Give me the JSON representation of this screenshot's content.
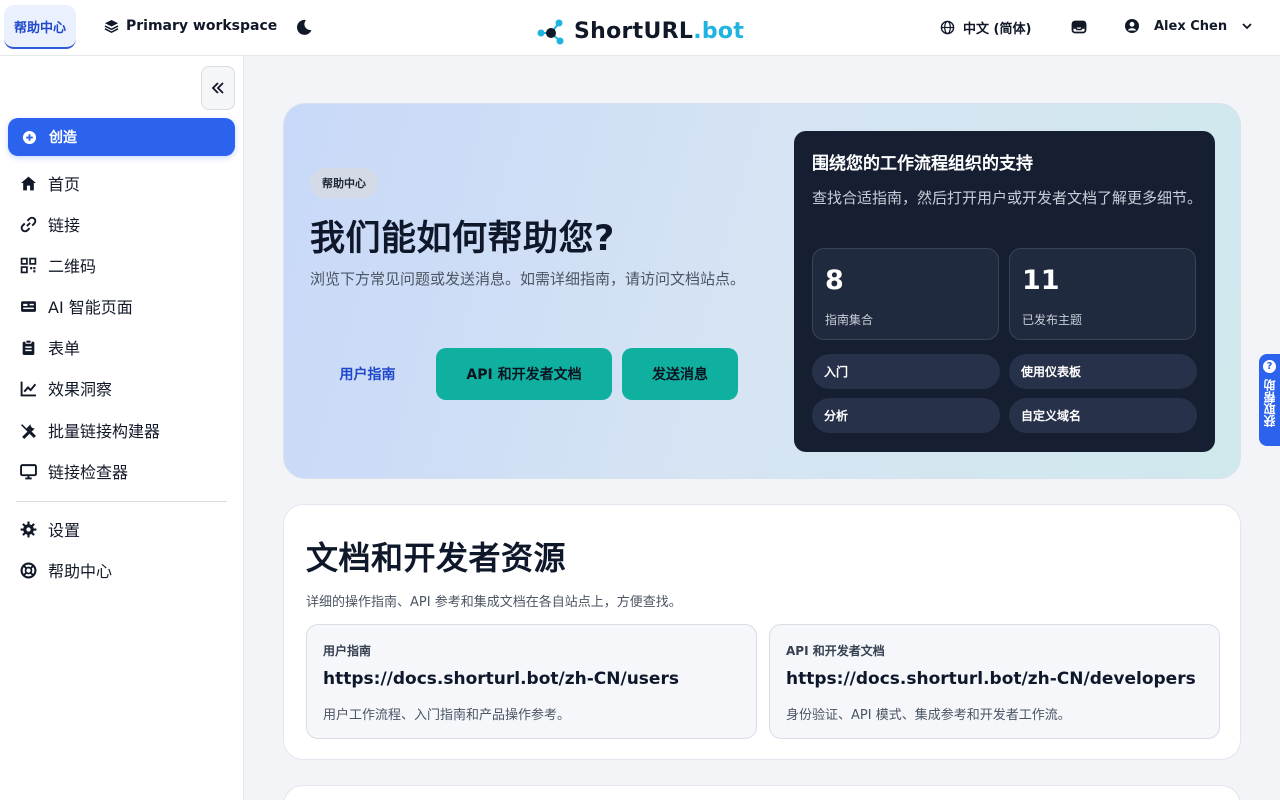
{
  "topbar": {
    "help_tab": "帮助中心",
    "workspace": "Primary workspace",
    "logo_main": "ShortURL",
    "logo_suffix": ".bot",
    "language": "中文 (简体)",
    "user_name": "Alex Chen"
  },
  "sidebar": {
    "create_label": "创造",
    "items": [
      {
        "label": "首页",
        "icon": "home-icon"
      },
      {
        "label": "链接",
        "icon": "link-icon"
      },
      {
        "label": "二维码",
        "icon": "qr-code-icon"
      },
      {
        "label": "AI 智能页面",
        "icon": "id-card-icon"
      },
      {
        "label": "表单",
        "icon": "clipboard-icon"
      },
      {
        "label": "效果洞察",
        "icon": "chart-line-icon"
      },
      {
        "label": "批量链接构建器",
        "icon": "tools-icon"
      },
      {
        "label": "链接检查器",
        "icon": "monitor-icon"
      },
      {
        "label": "设置",
        "icon": "gear-icon"
      },
      {
        "label": "帮助中心",
        "icon": "life-ring-icon"
      }
    ]
  },
  "hero": {
    "badge": "帮助中心",
    "title": "我们能如何帮助您?",
    "subtitle": "浏览下方常见问题或发送消息。如需详细指南，请访问文档站点。",
    "btn_user_guide": "用户指南",
    "btn_api_docs": "API 和开发者文档",
    "btn_send_message": "发送消息",
    "card": {
      "title": "围绕您的工作流程组织的支持",
      "desc": "查找合适指南，然后打开用户或开发者文档了解更多细节。",
      "stats": [
        {
          "value": "8",
          "label": "指南集合"
        },
        {
          "value": "11",
          "label": "已发布主题"
        }
      ],
      "topics": [
        "入门",
        "使用仪表板",
        "分析",
        "自定义域名"
      ]
    }
  },
  "docs": {
    "title": "文档和开发者资源",
    "subtitle": "详细的操作指南、API 参考和集成文档在各自站点上，方便查找。",
    "cards": [
      {
        "label": "用户指南",
        "url": "https://docs.shorturl.bot/zh-CN/users",
        "desc": "用户工作流程、入门指南和产品操作参考。"
      },
      {
        "label": "API 和开发者文档",
        "url": "https://docs.shorturl.bot/zh-CN/developers",
        "desc": "身份验证、API 模式、集成参考和开发者工作流。"
      }
    ]
  },
  "floating": {
    "get_help": "获取帮助"
  },
  "colors": {
    "primary": "#2b63ef",
    "teal": "#0fb0a0",
    "dark_card": "#161e31",
    "logo_accent": "#1fb3df"
  }
}
